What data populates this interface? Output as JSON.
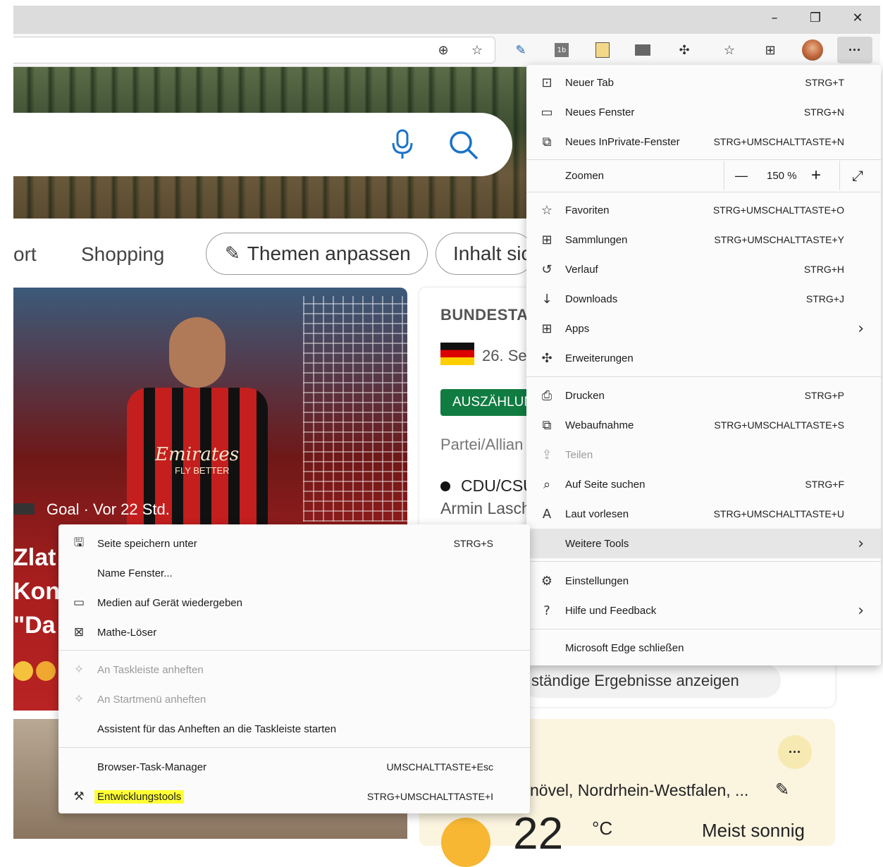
{
  "window": {
    "minimize_glyph": "–",
    "restore_glyph": "❐",
    "close_glyph": "✕"
  },
  "toolbar": {
    "icons": [
      "zoom-icon",
      "favorite-add-icon",
      "extension-1-icon",
      "extension-2-icon",
      "extension-3-icon",
      "extension-4-icon",
      "extensions-icon",
      "favorites-icon",
      "collections-icon",
      "profile-avatar",
      "settings-more-icon"
    ],
    "more_glyph": "···"
  },
  "page": {
    "nav": {
      "item_partial": "ort",
      "shopping": "Shopping",
      "customize": "Themen anpassen",
      "content_partial": "Inhalt sic"
    },
    "news": {
      "source": "Goal · Vor 22 Std.",
      "headline_lines": [
        "Zlat",
        "Kon",
        "\"Da"
      ],
      "shirt_text": "Emirates",
      "shirt_subtext": "FLY BETTER"
    },
    "election": {
      "title": "BUNDESTA",
      "date": "26. Se",
      "badge": "AUSZÄHLUN",
      "column": "Partei/Allian",
      "party": "CDU/CSU",
      "candidate": "Armin Lasch",
      "more_results": "ständige Ergebnisse anzeigen"
    },
    "weather": {
      "more": "···",
      "location": "növel, Nordrhein-Westfalen, ...",
      "temp": "22",
      "unit": "°C",
      "condition": "Meist sonnig"
    }
  },
  "main_menu": {
    "items": [
      {
        "label": "Neuer Tab",
        "shortcut": "STRG+T",
        "icon": "new-tab-icon"
      },
      {
        "label": "Neues Fenster",
        "shortcut": "STRG+N",
        "icon": "new-window-icon"
      },
      {
        "label": "Neues InPrivate-Fenster",
        "shortcut": "STRG+UMSCHALTTASTE+N",
        "icon": "inprivate-icon"
      }
    ],
    "zoom": {
      "label": "Zoomen",
      "minus": "—",
      "value": "150 %",
      "plus": "+",
      "fullscreen": "⤢"
    },
    "items2": [
      {
        "label": "Favoriten",
        "shortcut": "STRG+UMSCHALTTASTE+O",
        "icon": "favorites-icon"
      },
      {
        "label": "Sammlungen",
        "shortcut": "STRG+UMSCHALTTASTE+Y",
        "icon": "collections-icon"
      },
      {
        "label": "Verlauf",
        "shortcut": "STRG+H",
        "icon": "history-icon"
      },
      {
        "label": "Downloads",
        "shortcut": "STRG+J",
        "icon": "downloads-icon"
      },
      {
        "label": "Apps",
        "shortcut": "",
        "icon": "apps-icon"
      },
      {
        "label": "Erweiterungen",
        "shortcut": "",
        "icon": "extensions-icon"
      }
    ],
    "items3": [
      {
        "label": "Drucken",
        "shortcut": "STRG+P",
        "icon": "print-icon"
      },
      {
        "label": "Webaufnahme",
        "shortcut": "STRG+UMSCHALTTASTE+S",
        "icon": "web-capture-icon"
      },
      {
        "label": "Teilen",
        "shortcut": "",
        "icon": "share-icon"
      },
      {
        "label": "Auf Seite suchen",
        "shortcut": "STRG+F",
        "icon": "find-icon"
      },
      {
        "label": "Laut vorlesen",
        "shortcut": "STRG+UMSCHALTTASTE+U",
        "icon": "read-aloud-icon"
      },
      {
        "label": "Weitere Tools",
        "shortcut": "",
        "icon": ""
      }
    ],
    "items4": [
      {
        "label": "Einstellungen",
        "shortcut": "",
        "icon": "settings-icon"
      },
      {
        "label": "Hilfe und Feedback",
        "shortcut": "",
        "icon": "help-icon"
      }
    ],
    "close": {
      "label": "Microsoft Edge schließen"
    },
    "arrow_glyph": "›"
  },
  "sub_menu": {
    "items": [
      {
        "label": "Seite speichern unter",
        "shortcut": "STRG+S",
        "icon": "save-page-icon"
      },
      {
        "label": "Name Fenster...",
        "shortcut": "",
        "icon": ""
      },
      {
        "label": "Medien auf Gerät wiedergeben",
        "shortcut": "",
        "icon": "cast-icon"
      },
      {
        "label": "Mathe-Löser",
        "shortcut": "",
        "icon": "math-solver-icon"
      }
    ],
    "items2": [
      {
        "label": "An Taskleiste anheften",
        "shortcut": "",
        "icon": "pin-icon"
      },
      {
        "label": "An Startmenü anheften",
        "shortcut": "",
        "icon": "pin-icon"
      },
      {
        "label": "Assistent für das Anheften an die Taskleiste starten",
        "shortcut": "",
        "icon": ""
      }
    ],
    "items3": [
      {
        "label": "Browser-Task-Manager",
        "shortcut": "UMSCHALTTASTE+Esc",
        "icon": ""
      },
      {
        "label": "Entwicklungstools",
        "shortcut": "STRG+UMSCHALTTASTE+I",
        "icon": "devtools-icon"
      }
    ]
  },
  "colors": {
    "highlight": "#ffff33",
    "badge_green": "#107c41",
    "news_red": "#b92323"
  }
}
